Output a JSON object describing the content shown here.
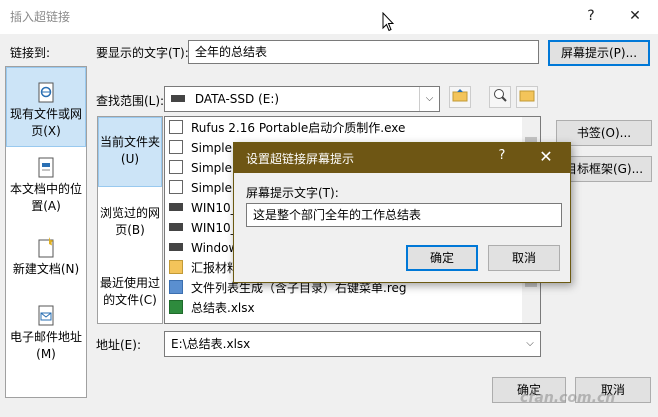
{
  "window": {
    "title": "插入超链接",
    "help": "?",
    "close": "✕"
  },
  "link_to": {
    "label": "链接到:",
    "items": [
      {
        "label": "现有文件或网页(X)",
        "icon": "globe-document-icon"
      },
      {
        "label": "本文档中的位置(A)",
        "icon": "document-place-icon"
      },
      {
        "label": "新建文档(N)",
        "icon": "new-document-icon"
      },
      {
        "label": "电子邮件地址(M)",
        "icon": "email-icon"
      }
    ]
  },
  "display_text": {
    "label": "要显示的文字(T):",
    "value": "全年的总结表"
  },
  "screentip_button": "屏幕提示(P)...",
  "look_in": {
    "label": "查找范围(L):",
    "value": "DATA-SSD (E:)"
  },
  "browse": {
    "current_folder": "当前文件夹(U)",
    "browsed_pages": "浏览过的网页(B)",
    "recent_files": "最近使用过的文件(C)"
  },
  "files": [
    {
      "name": "Rufus 2.16 Portable启动介质制作.exe",
      "icon": "app-icon"
    },
    {
      "name": "Simple V",
      "icon": "file-icon"
    },
    {
      "name": "Simple V",
      "icon": "file-icon"
    },
    {
      "name": "Simple V",
      "icon": "file-icon"
    },
    {
      "name": "WIN10_1",
      "icon": "drive-icon"
    },
    {
      "name": "WIN10_",
      "icon": "drive-icon"
    },
    {
      "name": "Window",
      "icon": "drive-icon"
    },
    {
      "name": "汇报材料",
      "icon": "folder-icon"
    },
    {
      "name": "文件列表生成（含子目录）右键菜单.reg",
      "icon": "reg-icon"
    },
    {
      "name": "总结表.xlsx",
      "icon": "xlsx-icon"
    }
  ],
  "bookmark_button": "书签(O)...",
  "target_frame_button": "目标框架(G)...",
  "address": {
    "label": "地址(E):",
    "value": "E:\\总结表.xlsx"
  },
  "ok_button": "确定",
  "cancel_button": "取消",
  "screentip_dialog": {
    "title": "设置超链接屏幕提示",
    "help": "?",
    "close": "✕",
    "label": "屏幕提示文字(T):",
    "value": "这是整个部门全年的工作总结表",
    "ok": "确定",
    "cancel": "取消"
  },
  "watermark": "cfan.com.cn"
}
